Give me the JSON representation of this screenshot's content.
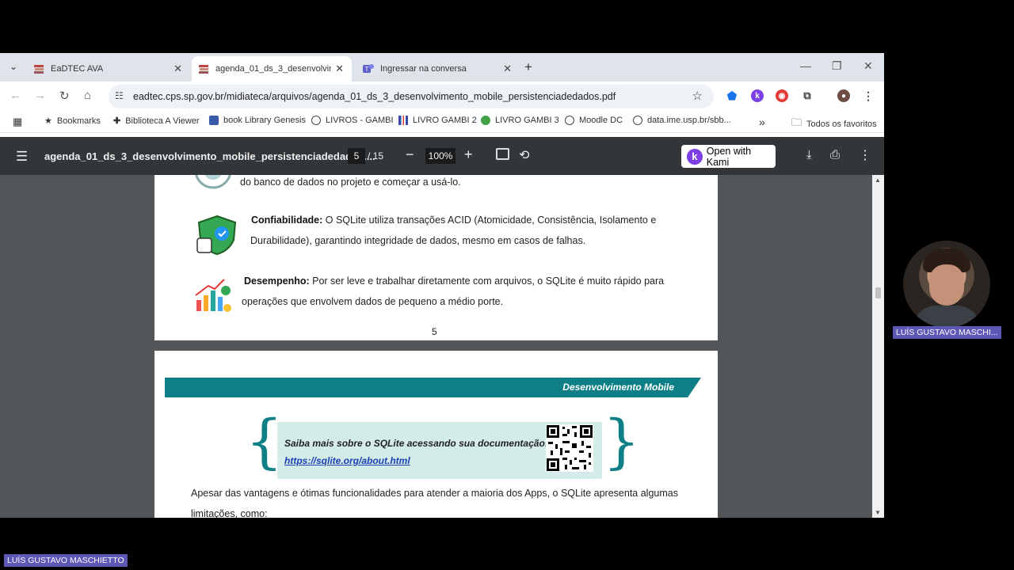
{
  "browser": {
    "tabs": [
      {
        "label": "EaDTEC AVA",
        "active": false,
        "icon": "stack-books-icon"
      },
      {
        "label": "agenda_01_ds_3_desenvolvimen",
        "active": true,
        "icon": "stack-books-icon"
      },
      {
        "label": "Ingressar na conversa",
        "active": false,
        "icon": "teams-icon"
      }
    ],
    "url": "eadtec.cps.sp.gov.br/midiateca/arquivos/agenda_01_ds_3_desenvolvimento_mobile_persistenciadedados.pdf",
    "bookmarks": [
      {
        "label": "Bookmarks",
        "icon": "star-icon"
      },
      {
        "label": "Biblioteca A Viewer",
        "icon": "plus-icon"
      },
      {
        "label": "book Library Genesis",
        "icon": "book-icon"
      },
      {
        "label": "LIVROS - GAMBI",
        "icon": "globe-icon"
      },
      {
        "label": "LIVRO GAMBI 2",
        "icon": "bars-icon"
      },
      {
        "label": "LIVRO GAMBI 3",
        "icon": "green-dot-icon"
      },
      {
        "label": "Moodle DC",
        "icon": "globe-icon"
      },
      {
        "label": "data.ime.usp.br/sbb...",
        "icon": "globe-icon"
      }
    ],
    "all_bookmarks": "Todos os favoritos",
    "more_bookmarks": "»"
  },
  "pdf": {
    "title": "agenda_01_ds_3_desenvolvimento_mobile_persistenciadedados....",
    "current_page": "5",
    "total_pages": "/ 15",
    "zoom": "100%",
    "kami_label": "Open with Kami"
  },
  "page5": {
    "line_top": "do banco de dados no projeto e começar a usá-lo.",
    "confiabilidade_title": "Confiabilidade:",
    "confiabilidade_text_1": " O SQLite utiliza transações ACID (Atomicidade, Consistência, Isolamento e",
    "confiabilidade_text_2": "Durabilidade), garantindo integridade de dados, mesmo em casos de falhas.",
    "desempenho_title": "Desempenho:",
    "desempenho_text_1": " Por ser leve e trabalhar diretamente com arquivos, o SQLite é muito rápido para",
    "desempenho_text_2": "operações que envolvem dados de pequeno a médio porte.",
    "page_number": "5"
  },
  "page6": {
    "banner": "Desenvolvimento Mobile",
    "callout_text": "Saiba mais sobre o SQLite acessando sua documentação:",
    "callout_link": "https://sqlite.org/about.html",
    "paragraph_1": "Apesar das vantagens e ótimas funcionalidades para atender a maioria dos Apps, o SQLite apresenta algumas",
    "paragraph_2": "limitações, como:"
  },
  "meeting": {
    "participant_tile_name": "LUÍS GUSTAVO MASCHI...",
    "presenter_name": "LUÍS GUSTAVO MASCHIETTO"
  }
}
